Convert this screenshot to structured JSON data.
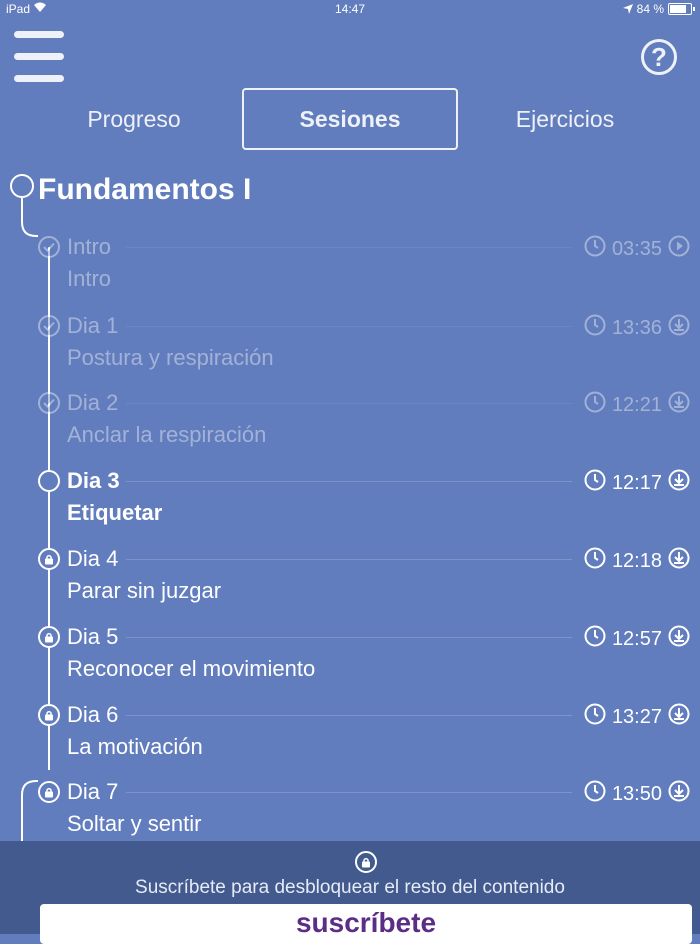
{
  "status_bar": {
    "device": "iPad",
    "time": "14:47",
    "battery": "84 %",
    "battery_level": 0.84
  },
  "header": {
    "menu_icon": "hamburger-menu-icon",
    "help_label": "?"
  },
  "tabs": [
    {
      "label": "Progreso",
      "active": false
    },
    {
      "label": "Sesiones",
      "active": true
    },
    {
      "label": "Ejercicios",
      "active": false
    }
  ],
  "course": {
    "title": "Fundamentos I"
  },
  "sessions": [
    {
      "day": "Intro",
      "name": "Intro",
      "duration": "03:35",
      "state": "completed",
      "action_icon": "play-icon"
    },
    {
      "day": "Dia 1",
      "name": "Postura y respiración",
      "duration": "13:36",
      "state": "completed",
      "action_icon": "download-icon"
    },
    {
      "day": "Dia 2",
      "name": "Anclar la respiración",
      "duration": "12:21",
      "state": "completed",
      "action_icon": "download-icon"
    },
    {
      "day": "Dia 3",
      "name": "Etiquetar",
      "duration": "12:17",
      "state": "current",
      "action_icon": "download-icon"
    },
    {
      "day": "Dia 4",
      "name": "Parar sin juzgar",
      "duration": "12:18",
      "state": "locked",
      "action_icon": "download-icon"
    },
    {
      "day": "Dia 5",
      "name": "Reconocer el movimiento",
      "duration": "12:57",
      "state": "locked",
      "action_icon": "download-icon"
    },
    {
      "day": "Dia 6",
      "name": "La motivación",
      "duration": "13:27",
      "state": "locked",
      "action_icon": "download-icon"
    },
    {
      "day": "Dia 7",
      "name": "Soltar y sentir",
      "duration": "13:50",
      "state": "locked",
      "action_icon": "download-icon"
    }
  ],
  "banner": {
    "text": "Suscríbete para desbloquear el resto del contenido",
    "button_label": "suscríbete"
  },
  "colors": {
    "background": "#627dbd",
    "banner": "#435a8e",
    "button_text": "#5b2d85"
  }
}
